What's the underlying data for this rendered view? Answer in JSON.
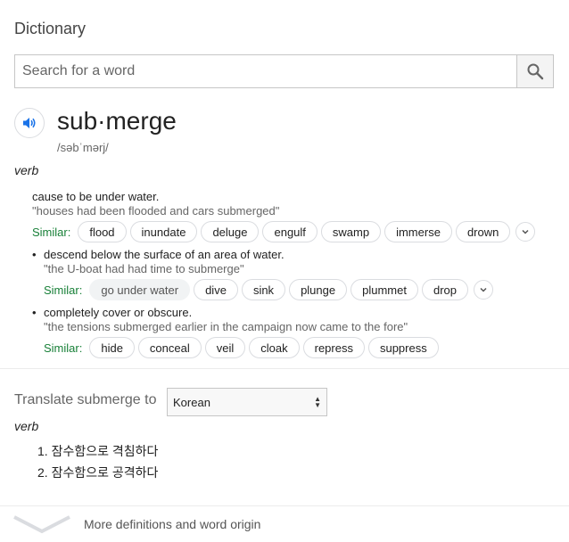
{
  "title": "Dictionary",
  "search": {
    "placeholder": "Search for a word"
  },
  "headword": {
    "word": "sub·merge",
    "pronunciation": "/səbˈmərj/"
  },
  "pos": "verb",
  "senses": [
    {
      "definition": "cause to be under water.",
      "example": "\"houses had been flooded and cars submerged\"",
      "similar_label": "Similar:",
      "similar": [
        "flood",
        "inundate",
        "deluge",
        "engulf",
        "swamp",
        "immerse",
        "drown"
      ]
    },
    {
      "definition": "descend below the surface of an area of water.",
      "example": "\"the U-boat had had time to submerge\"",
      "similar_label": "Similar:",
      "similar": [
        "go under water",
        "dive",
        "sink",
        "plunge",
        "plummet",
        "drop"
      ]
    },
    {
      "definition": "completely cover or obscure.",
      "example": "\"the tensions submerged earlier in the campaign now came to the fore\"",
      "similar_label": "Similar:",
      "similar": [
        "hide",
        "conceal",
        "veil",
        "cloak",
        "repress",
        "suppress"
      ]
    }
  ],
  "translate": {
    "label": "Translate submerge to",
    "language": "Korean",
    "pos": "verb",
    "items": [
      "1. 잠수함으로 격침하다",
      "2. 잠수함으로 공격하다"
    ]
  },
  "footer": {
    "more_label": "More definitions and word origin"
  },
  "icons": {
    "search": "search-icon",
    "speaker": "speaker-icon",
    "expand": "chevron-down-icon"
  },
  "colors": {
    "accent_blue": "#1a73e8",
    "similar_green": "#188038"
  }
}
